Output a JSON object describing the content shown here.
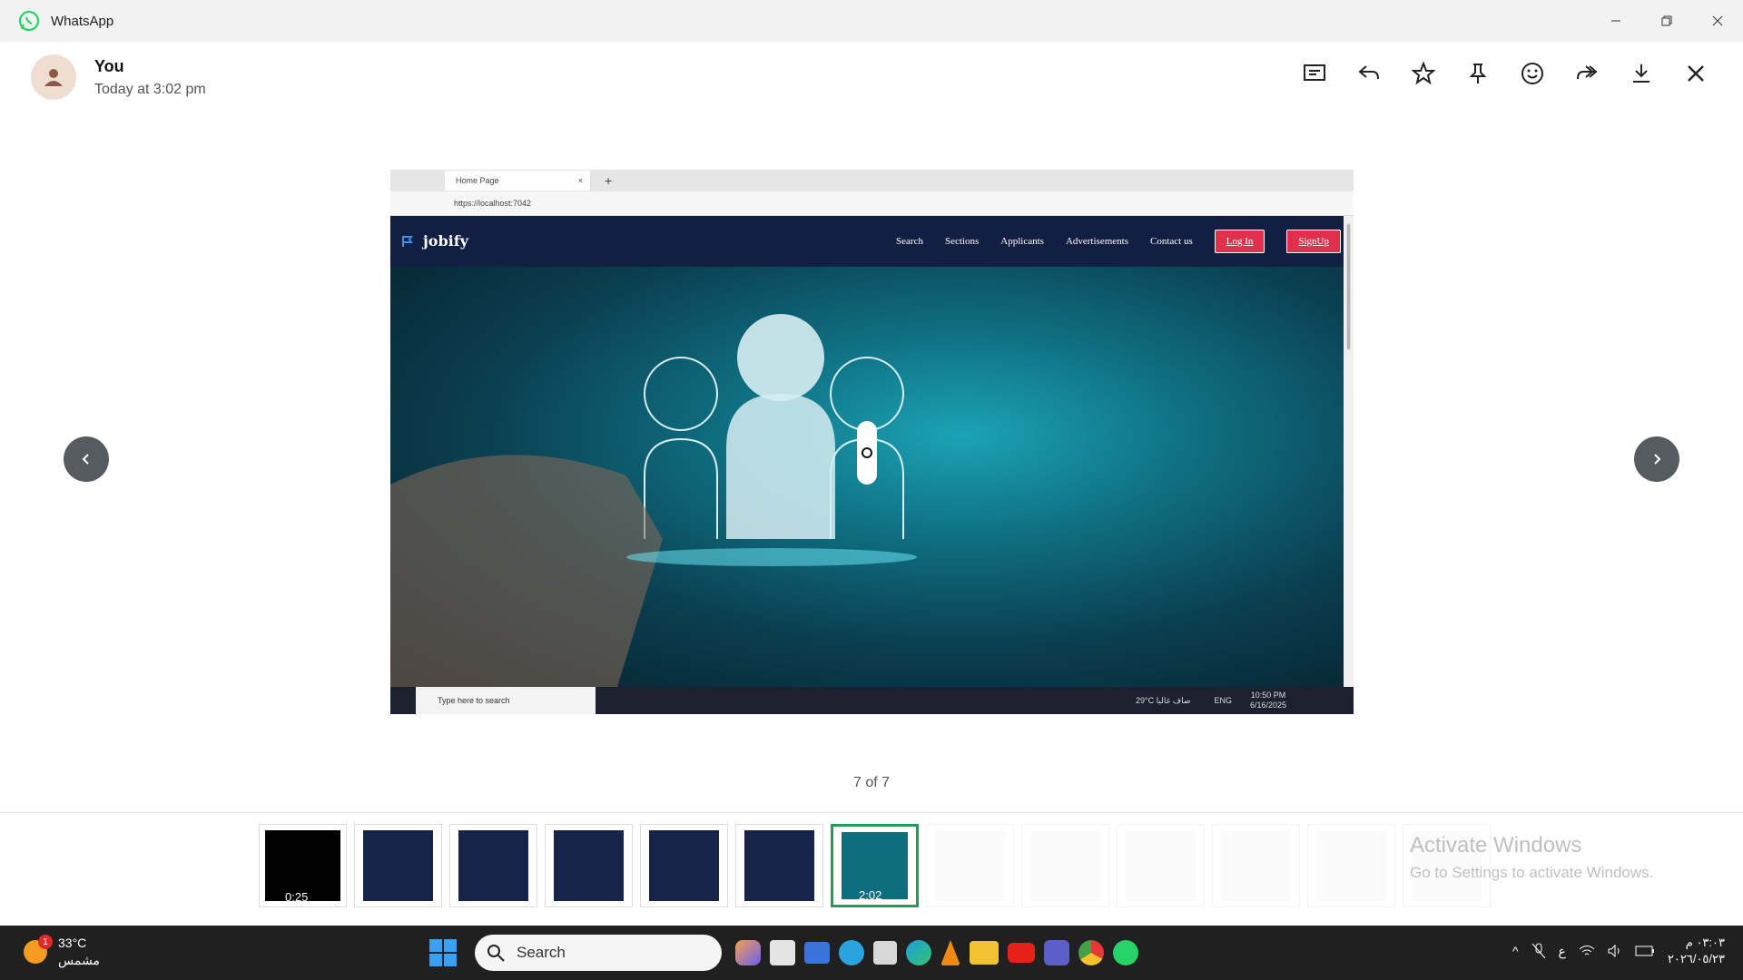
{
  "window": {
    "title": "WhatsApp"
  },
  "sender": {
    "name": "You",
    "time": "Today at 3:02 pm"
  },
  "toolbar": {
    "icons": [
      "message-icon",
      "reply-icon",
      "star-icon",
      "pin-icon",
      "emoji-icon",
      "forward-icon",
      "download-icon",
      "close-icon"
    ]
  },
  "media": {
    "tab_title": "Home Page",
    "url": "https://localhost:7042",
    "brand": "jobify",
    "nav_links": [
      "Search",
      "Sections",
      "Applicants",
      "Advertisements",
      "Contact us"
    ],
    "login_label": "Log In",
    "signup_label": "SignUp",
    "taskbar_search": "Type here to search",
    "taskbar_weather": "29°C صاف غالبا",
    "taskbar_lang": "ENG",
    "taskbar_time": "10:50 PM",
    "taskbar_date": "6/16/2025"
  },
  "counter": "7 of 7",
  "thumbnails": [
    {
      "kind": "video",
      "duration": "0:25"
    },
    {
      "kind": "image"
    },
    {
      "kind": "image"
    },
    {
      "kind": "image"
    },
    {
      "kind": "image"
    },
    {
      "kind": "image"
    },
    {
      "kind": "video",
      "duration": "2:02",
      "selected": true
    },
    {
      "kind": "faded"
    },
    {
      "kind": "faded"
    },
    {
      "kind": "faded"
    },
    {
      "kind": "faded"
    },
    {
      "kind": "faded"
    },
    {
      "kind": "faded"
    }
  ],
  "activate": {
    "title": "Activate Windows",
    "subtitle": "Go to Settings to activate Windows."
  },
  "taskbar": {
    "weather_temp": "33°C",
    "weather_desc": "مشمس",
    "weather_badge": "1",
    "search_label": "Search",
    "lang": "ع",
    "time": "٠٣:٠٣ م",
    "date": "٢٠٢٦/٠٥/٢٣"
  },
  "colors": {
    "accent": "#25d366",
    "brand_nav": "#121f42",
    "cta": "#e0304e"
  }
}
